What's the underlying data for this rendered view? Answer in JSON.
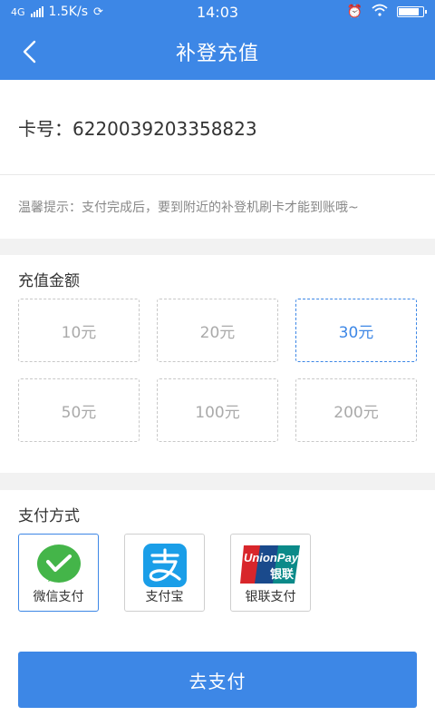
{
  "status_bar": {
    "network": "4G",
    "speed": "1.5K/s",
    "time": "14:03"
  },
  "header": {
    "title": "补登充值"
  },
  "card": {
    "number_text": "卡号：6220039203358823"
  },
  "tip": {
    "text": "温馨提示：支付完成后，要到附近的补登机刷卡才能到账哦~"
  },
  "amount": {
    "title": "充值金额",
    "options": [
      "10元",
      "20元",
      "30元",
      "50元",
      "100元",
      "200元"
    ],
    "selected_index": 2
  },
  "payment": {
    "title": "支付方式",
    "methods": [
      {
        "label": "微信支付",
        "icon": "wechat-pay-icon",
        "color": "#44b549"
      },
      {
        "label": "支付宝",
        "icon": "alipay-icon",
        "color": "#1a9ee8"
      },
      {
        "label": "银联支付",
        "icon": "unionpay-icon",
        "color": "#d8262b"
      }
    ],
    "selected_index": 0
  },
  "unionpay_logo": {
    "text_top": "UnionPay",
    "text_bottom": "银联"
  },
  "submit": {
    "label": "去支付"
  },
  "colors": {
    "primary": "#3d87e6",
    "border": "#c8c8c8",
    "muted": "#aaaaaa"
  }
}
